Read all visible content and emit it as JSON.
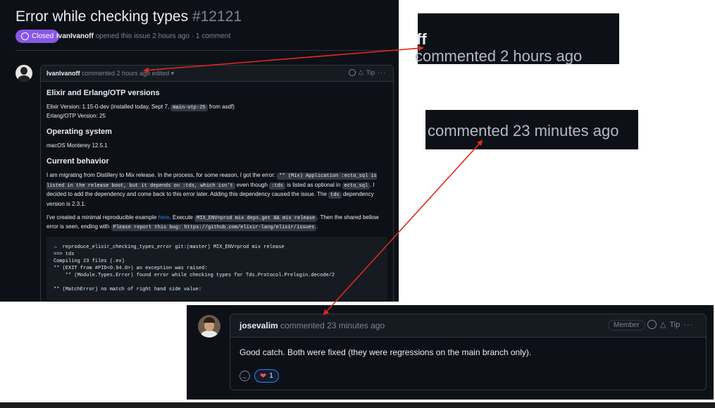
{
  "issue": {
    "title": "Error while checking types",
    "number": "#12121",
    "status": "Closed",
    "meta_author": "IvanIvanoff",
    "meta_text": "opened this issue 2 hours ago · 1 comment"
  },
  "first_comment": {
    "author": "IvanIvanoff",
    "time": "commented 2 hours ago",
    "edited": "edited",
    "tip": "Tip",
    "heading_versions": "Elixir and Erlang/OTP versions",
    "elixir_version_prefix": "Elixir Version: 1.15-0-dev (installed today, Sept 7,",
    "elixir_version_code": "main-otp-25",
    "elixir_version_suffix": "from asdf)",
    "otp_version": "Erlang/OTP Version: 25",
    "heading_os": "Operating system",
    "os": "macOS Monterey 12.5.1",
    "heading_behavior": "Current behavior",
    "behavior_1": "I am migrating from Distillery to Mix release. In the process, for some reason, I got the error:",
    "behavior_code_1": "** (Mix) Application :ecto_sql is listed in the release boot, but it depends on :tds, which isn't",
    "behavior_2": "even though",
    "behavior_code_2": ":tds",
    "behavior_3": "is listed as optional in",
    "behavior_code_3": "ecto_sql",
    "behavior_4": ". I decided to add the dependency and come back to this error later. Adding this dependency caused the issue. The",
    "behavior_code_4": "tds",
    "behavior_5": "dependency version is 2.3.1.",
    "repro_1": "I've created a minimal reproducible example",
    "repro_link": "here",
    "repro_2": ". Execute",
    "repro_code_1": "MIX_ENV=prod mix deps.get && mix release",
    "repro_3": ". Then the shared bellow error is seen, ending with",
    "repro_code_2": "Please report this bug: https://github.com/elixir-lang/elixir/issues",
    "repro_4": ".",
    "code_block": "→  reproduce_elixir_checking_types_error git:(master) MIX_ENV=prod mix release\n==> tds\nCompiling 23 files (.ex)\n** (EXIT from #PID<0.94.0>) an exception was raised:\n    ** (Module.Types.Error) found error while checking types for Tds.Protocol.Prelogin.decode/2\n\n** (MatchError) no match of right hand side value:"
  },
  "zoom1": {
    "author_tail": "ff",
    "text": "commented 2 hours ago",
    "tail": "·"
  },
  "zoom2": {
    "text": "commented 23 minutes ago"
  },
  "second_comment": {
    "author": "josevalim",
    "time": "commented 23 minutes ago",
    "role": "Member",
    "tip": "Tip",
    "body": "Good catch. Both were fixed (they were regressions on the main branch only).",
    "reaction_count": "1"
  },
  "icons": [
    "closed-issue-icon",
    "smiley-icon",
    "triangle-tip-icon",
    "kebab-menu-icon",
    "heart-icon",
    "caret-down-icon"
  ],
  "colors": {
    "background": "#0d1117",
    "closed_badge": "#8957e5",
    "link": "#2f81f7",
    "arrow": "#e0281e"
  }
}
